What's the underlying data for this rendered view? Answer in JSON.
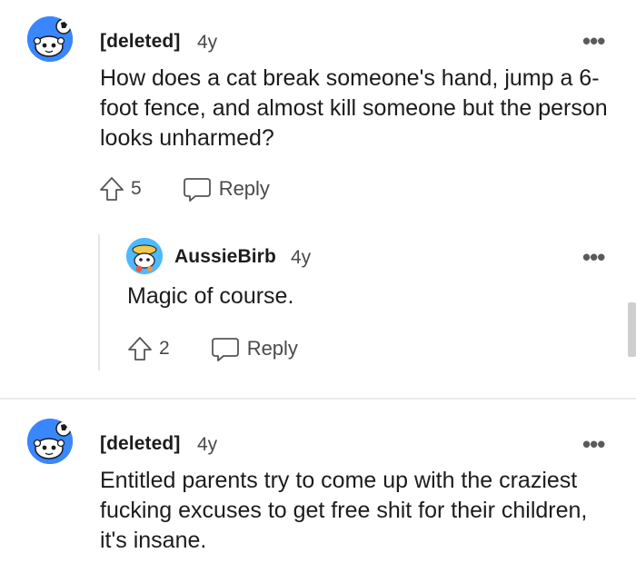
{
  "comments": [
    {
      "author": "[deleted]",
      "age": "4y",
      "text": "How does a cat break someone's hand, jump a 6-foot fence, and almost kill someone but the person looks unharmed?",
      "upvotes": "5",
      "reply_label": "Reply",
      "avatar_icon": "snoo-avatar-icon"
    },
    {
      "author": "AussieBirb",
      "age": "4y",
      "text": "Magic of course.",
      "upvotes": "2",
      "reply_label": "Reply",
      "avatar_icon": "snoo-avatar-icon"
    },
    {
      "author": "[deleted]",
      "age": "4y",
      "text": "Entitled parents try to come up with the craziest fucking excuses to get free shit for their children, it's insane.",
      "avatar_icon": "snoo-avatar-icon"
    }
  ],
  "more_icon": "•••",
  "colors": {
    "avatar_blue": "#3a86ff",
    "text": "#1c1c1c",
    "muted": "#4a4a4a"
  }
}
